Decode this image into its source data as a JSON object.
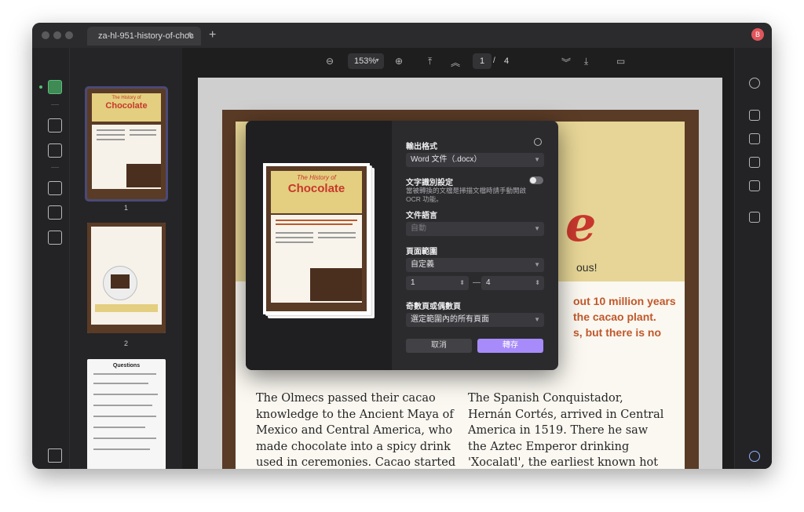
{
  "tab": {
    "title": "za-hl-951-history-of-choc",
    "edit_icon": "pencil-icon",
    "add_icon": "plus-icon"
  },
  "user": {
    "initial": "B"
  },
  "toolbar": {
    "zoom": "153%",
    "current_page": "1",
    "separator": "/",
    "total_pages": "4"
  },
  "thumbnails": [
    {
      "number": "1",
      "title_line1": "The History of",
      "title_line2": "Chocolate"
    },
    {
      "number": "2"
    },
    {
      "number": "3",
      "title": "Questions"
    }
  ],
  "document": {
    "big_letter": "e",
    "partial_line": "ous!",
    "red_lines": [
      "out 10 million years",
      "the cacao plant.",
      "s, but there is no"
    ],
    "col1": "The Olmecs passed their cacao knowledge to the Ancient Maya of Mexico and Central America, who made chocolate into a spicy drink used in ceremonies. Cacao started to become very precious. Later the Aztecs",
    "col2": "The Spanish Conquistador, Hernán Cortés, arrived in Central America in 1519. There he saw the Aztec Emperor drinking 'Xocalatl', the earliest known hot chocolate, and Cortés realised the great value that it had. Almost ten"
  },
  "dialog": {
    "preview": {
      "title_line1": "The History of",
      "title_line2": "Chocolate"
    },
    "output_format_label": "輸出格式",
    "output_format_value": "Word 文件（.docx）",
    "ocr_label": "文字識別設定",
    "ocr_hint": "當被轉換的文檔是掃描文檔時請手動開啟 OCR 功能。",
    "language_label": "文件語言",
    "language_value": "自動",
    "range_label": "頁面範圍",
    "range_value": "自定義",
    "range_from": "1",
    "range_to": "4",
    "range_dash": "—",
    "odd_even_label": "奇數頁或偶數頁",
    "odd_even_value": "選定範圍內的所有頁面",
    "cancel_label": "取消",
    "convert_label": "轉存"
  },
  "colors": {
    "accent": "#a78bfa",
    "active_tool": "#3f8a55",
    "chocolate_red": "#c8372d"
  }
}
